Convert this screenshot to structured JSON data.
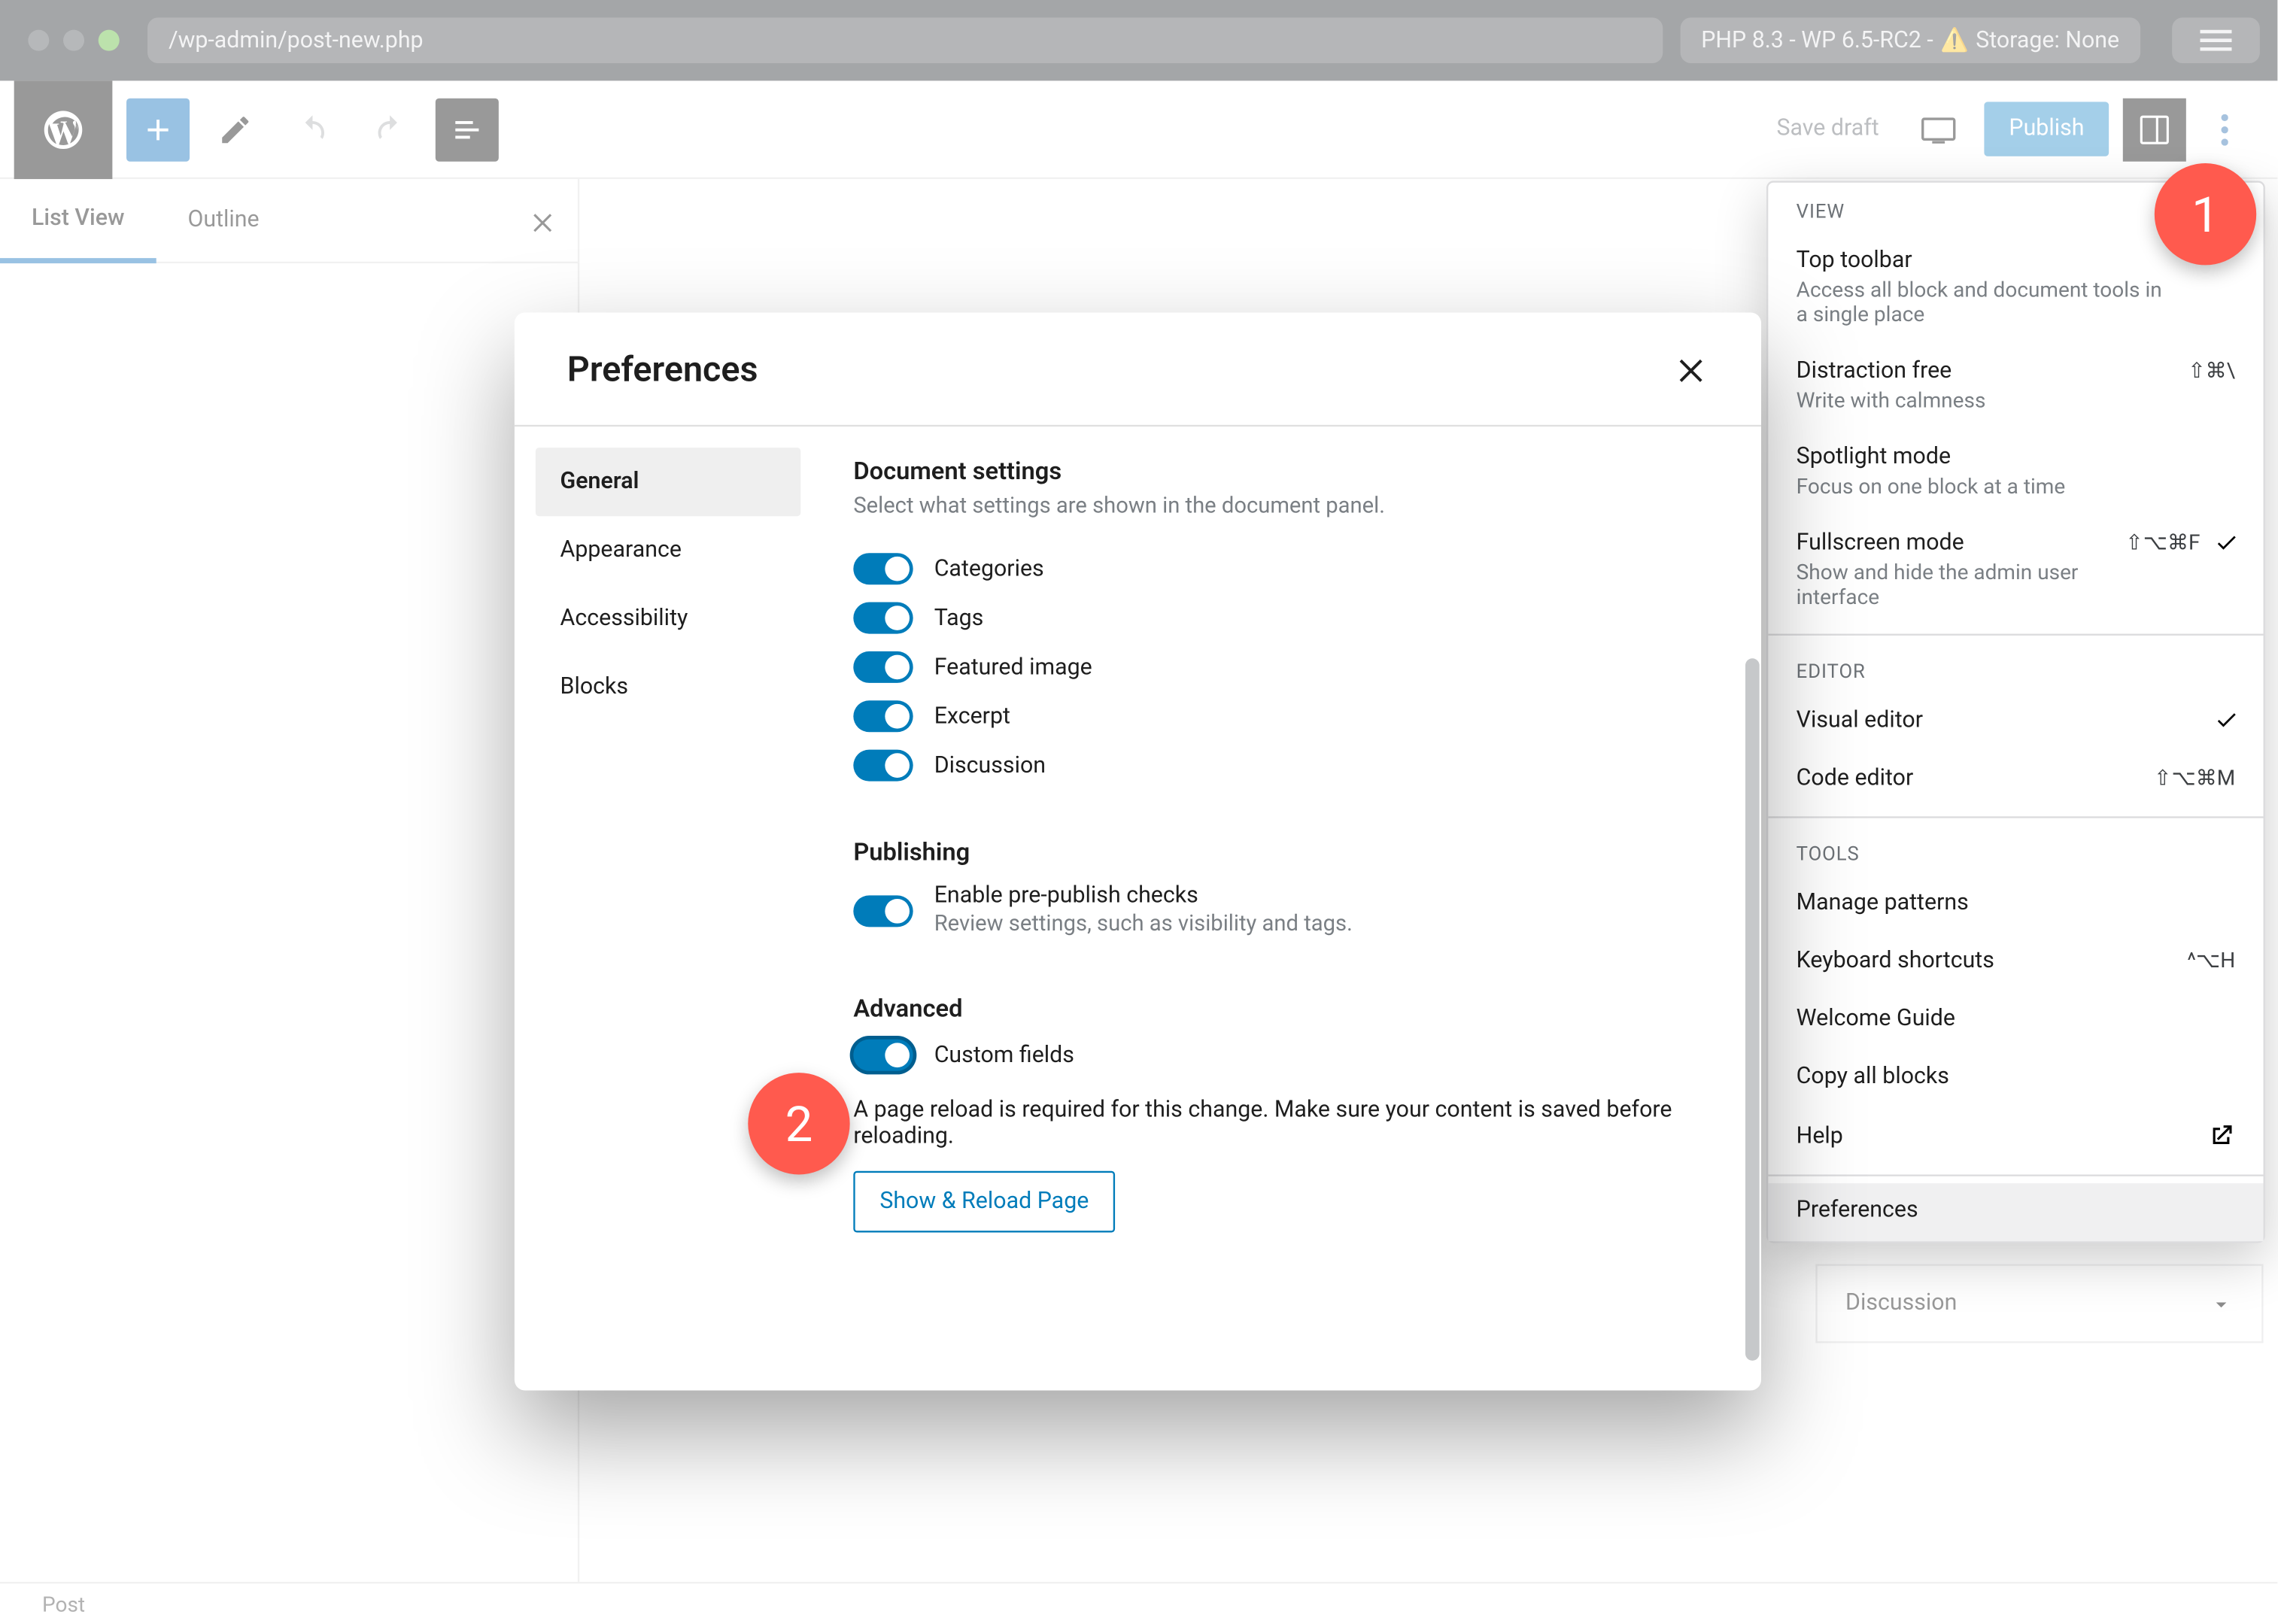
{
  "titlebar": {
    "url": "/wp-admin/post-new.php",
    "status_prefix": "PHP 8.3 - WP 6.5-RC2 - ",
    "status_warn": "⚠️",
    "status_suffix": " Storage: None"
  },
  "editor": {
    "save_draft": "Save draft",
    "publish": "Publish"
  },
  "sidebar_tabs": {
    "list_view": "List View",
    "outline": "Outline"
  },
  "right_panel": {
    "discussion": "Discussion"
  },
  "footer": {
    "post": "Post"
  },
  "dropdown": {
    "view_label": "VIEW",
    "top_toolbar": {
      "title": "Top toolbar",
      "desc": "Access all block and document tools in a single place"
    },
    "distraction_free": {
      "title": "Distraction free",
      "desc": "Write with calmness",
      "shortcut": "⇧⌘\\"
    },
    "spotlight": {
      "title": "Spotlight mode",
      "desc": "Focus on one block at a time"
    },
    "fullscreen": {
      "title": "Fullscreen mode",
      "desc": "Show and hide the admin user interface",
      "shortcut": "⇧⌥⌘F"
    },
    "editor_label": "EDITOR",
    "visual_editor": {
      "title": "Visual editor"
    },
    "code_editor": {
      "title": "Code editor",
      "shortcut": "⇧⌥⌘M"
    },
    "tools_label": "TOOLS",
    "manage_patterns": "Manage patterns",
    "keyboard_shortcuts": {
      "title": "Keyboard shortcuts",
      "shortcut": "^⌥H"
    },
    "welcome_guide": "Welcome Guide",
    "copy_all_blocks": "Copy all blocks",
    "help": "Help",
    "preferences": "Preferences"
  },
  "modal": {
    "title": "Preferences",
    "nav": {
      "general": "General",
      "appearance": "Appearance",
      "accessibility": "Accessibility",
      "blocks": "Blocks"
    },
    "doc_settings": {
      "heading": "Document settings",
      "sub": "Select what settings are shown in the document panel.",
      "categories": "Categories",
      "tags": "Tags",
      "featured_image": "Featured image",
      "excerpt": "Excerpt",
      "discussion": "Discussion"
    },
    "publishing": {
      "heading": "Publishing",
      "enable": "Enable pre-publish checks",
      "enable_help": "Review settings, such as visibility and tags."
    },
    "advanced": {
      "heading": "Advanced",
      "custom_fields": "Custom fields",
      "reload_note": "A page reload is required for this change. Make sure your content is saved before reloading.",
      "show_reload": "Show & Reload Page"
    }
  },
  "callouts": {
    "one": "1",
    "two": "2"
  }
}
